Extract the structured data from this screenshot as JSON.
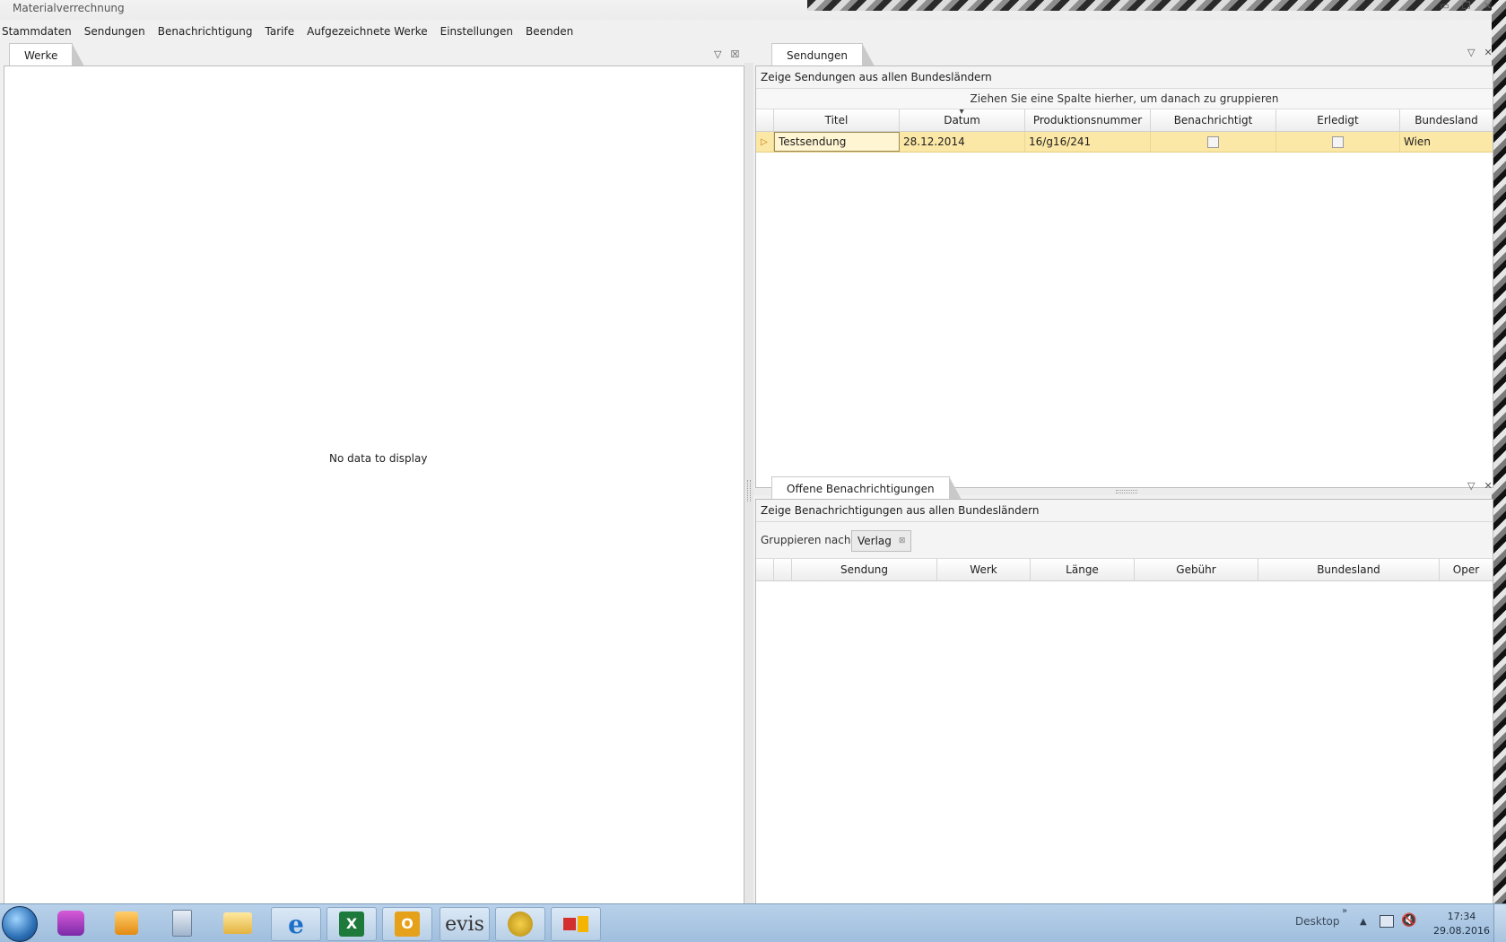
{
  "window": {
    "title": "Materialverrechnung"
  },
  "menu": [
    "Stammdaten",
    "Sendungen",
    "Benachrichtigung",
    "Tarife",
    "Aufgezeichnete Werke",
    "Einstellungen",
    "Beenden"
  ],
  "left_panel": {
    "tab": "Werke",
    "empty_text": "No data to display"
  },
  "sendungen_panel": {
    "tab": "Sendungen",
    "info": "Zeige Sendungen aus allen Bundesländern",
    "group_hint": "Ziehen Sie eine Spalte hierher, um danach zu gruppieren",
    "columns": [
      "Titel",
      "Datum",
      "Produktionsnummer",
      "Benachrichtigt",
      "Erledigt",
      "Bundesland"
    ],
    "rows": [
      {
        "titel": "Testsendung",
        "datum": "28.12.2014",
        "produktionsnummer": "16/g16/241",
        "benachrichtigt": false,
        "erledigt": false,
        "bundesland": "Wien"
      }
    ]
  },
  "benachrichtigungen_panel": {
    "tab": "Offene Benachrichtigungen",
    "info": "Zeige Benachrichtigungen aus allen Bundesländern",
    "group_label": "Gruppieren nach:",
    "group_chip": "Verlag",
    "columns": [
      "Sendung",
      "Werk",
      "Länge",
      "Gebühr",
      "Bundesland",
      "Oper"
    ]
  },
  "taskbar": {
    "apps": [
      "start-orb",
      "pro-icon",
      "media-icon",
      "calculator-icon",
      "explorer-icon",
      "ie-icon",
      "excel-icon",
      "outlook-icon",
      "evis-icon",
      "is-icon",
      "office-icon"
    ],
    "evis_label": "evis",
    "desktop_label": "Desktop",
    "time": "17:34",
    "date": "29.08.2016"
  }
}
